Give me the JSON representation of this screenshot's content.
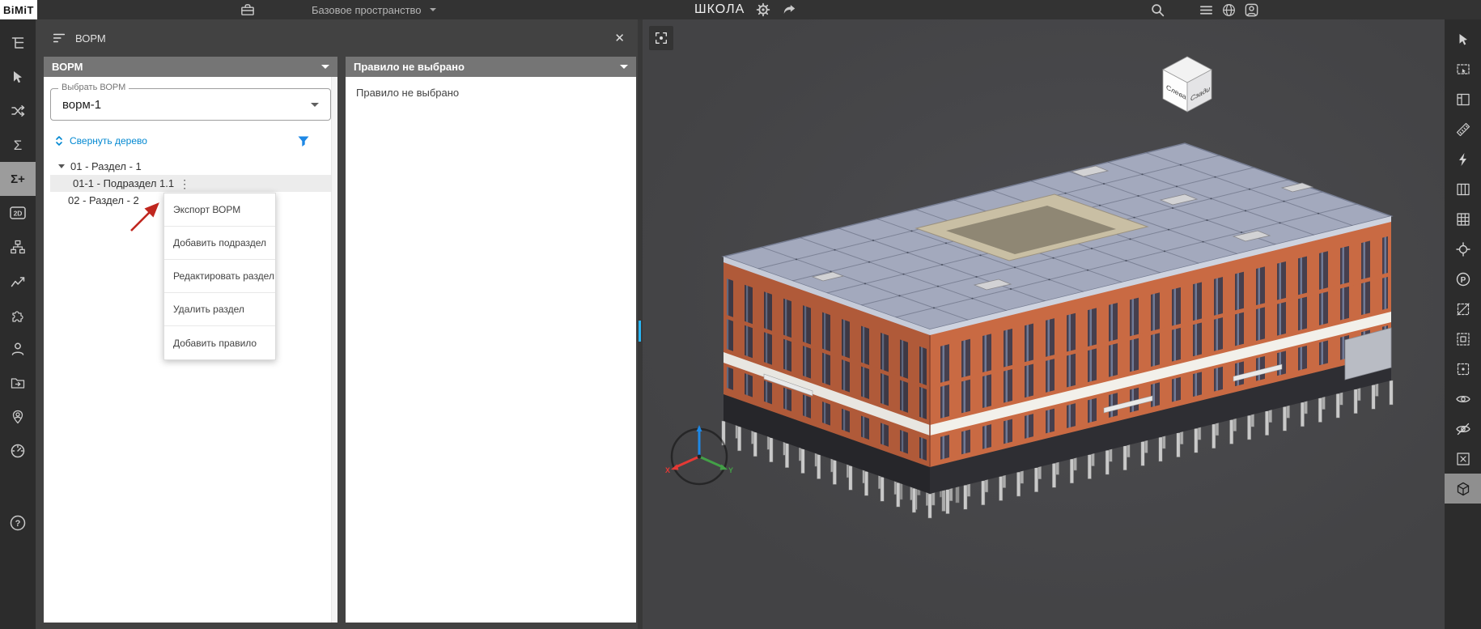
{
  "topbar": {
    "logo": "BiMiT",
    "workspace_label": "Базовое пространство",
    "project_title": "ШКОЛА"
  },
  "panels_header": {
    "title": "ВОРМ"
  },
  "bopm_panel": {
    "header_title": "ВОРМ",
    "select_label": "Выбрать ВОРМ",
    "select_value": "ворм-1",
    "collapse_tree_label": "Свернуть дерево",
    "tree": {
      "items": [
        {
          "label": "01 - Раздел - 1"
        },
        {
          "label": "01-1 - Подраздел 1.1"
        },
        {
          "label": "02 - Раздел - 2"
        }
      ]
    },
    "context_menu": {
      "items": [
        {
          "label": "Экспорт ВОРМ"
        },
        {
          "label": "Добавить подраздел"
        },
        {
          "label": "Редактировать раздел"
        },
        {
          "label": "Удалить раздел"
        },
        {
          "label": "Добавить правило"
        }
      ]
    }
  },
  "rule_panel": {
    "header_title": "Правило не выбрано",
    "empty_text": "Правило не выбрано"
  },
  "viewport": {
    "nav_cube": {
      "left_face": "Слева",
      "right_face": "Сзади"
    },
    "axes": {
      "x": "X",
      "y": "Y"
    }
  },
  "icons": {
    "sigma": "Σ",
    "sigma_plus": "Σ+",
    "two_d": "2D",
    "p": "P",
    "help": "?",
    "kebab": "⋮",
    "close": "✕"
  },
  "colors": {
    "accent_blue": "#1e88e5",
    "building_orange": "#c96a43",
    "roof_gray": "#a3a9bd",
    "annotation_red": "#c0271f"
  }
}
